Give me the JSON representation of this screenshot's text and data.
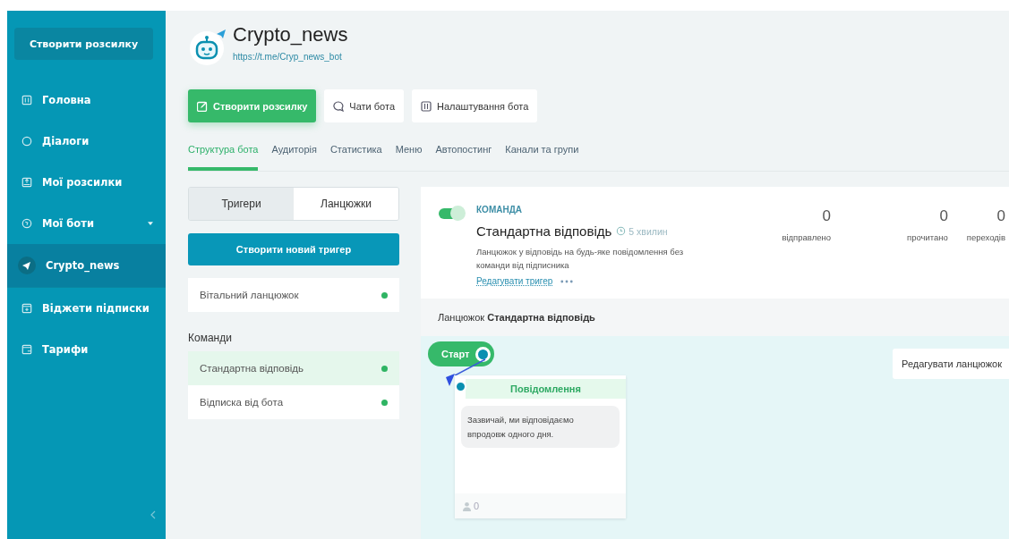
{
  "sidebar": {
    "create_button": "Створити розсилку",
    "items": [
      {
        "label": "Головна",
        "selected": false
      },
      {
        "label": "Діалоги",
        "selected": false
      },
      {
        "label": "Мої розсилки",
        "selected": false
      },
      {
        "label": "Мої боти",
        "selected": false,
        "expanded": true,
        "children": [
          {
            "label": "Crypto_news",
            "selected": true
          }
        ]
      },
      {
        "label": "Віджети підписки",
        "selected": false
      },
      {
        "label": "Тарифи",
        "selected": false
      }
    ]
  },
  "header": {
    "bot_name": "Crypto_news",
    "bot_link": "https://t.me/Cryp_news_bot"
  },
  "actions": [
    {
      "label": "Створити розсилку",
      "primary": true
    },
    {
      "label": "Чати бота",
      "primary": false
    },
    {
      "label": "Налаштування бота",
      "primary": false
    }
  ],
  "tabs": [
    {
      "label": "Структура бота",
      "selected": true
    },
    {
      "label": "Аудиторія",
      "selected": false
    },
    {
      "label": "Статистика",
      "selected": false
    },
    {
      "label": "Меню",
      "selected": false
    },
    {
      "label": "Автопостинг",
      "selected": false
    },
    {
      "label": "Канали та групи",
      "selected": false
    }
  ],
  "segments": [
    {
      "label": "Тригери",
      "selected": true
    },
    {
      "label": "Ланцюжки",
      "selected": false
    }
  ],
  "create_trigger_button": "Створити новий тригер",
  "triggers": [
    {
      "label": "Вітальний ланцюжок",
      "active": true,
      "selected": false
    }
  ],
  "commands_heading": "Команди",
  "commands": [
    {
      "label": "Стандартна відповідь",
      "active": true,
      "selected": true
    },
    {
      "label": "Відписка від бота",
      "active": true,
      "selected": false
    }
  ],
  "detail": {
    "on": true,
    "kind_label": "КОМАНДА",
    "title": "Стандартна відповідь",
    "delay": "5 хвилин",
    "description": "Ланцюжок у відповідь на будь-яке повідомлення без команди від підписника",
    "edit_link": "Редагувати тригер",
    "stats": [
      {
        "value": "0",
        "label": "відправлено"
      },
      {
        "value": "0",
        "label": "прочитано"
      },
      {
        "value": "0",
        "label": "переходів"
      }
    ]
  },
  "chain": {
    "heading": "Ланцюжок **Стандартна відповідь**",
    "start_label": "Старт",
    "edit_button": "Редагувати ланцюжок",
    "message": {
      "title": "Повідомлення",
      "text": "Зазвичай, ми відповідаємо впродовж одного дня.",
      "count": "0"
    }
  }
}
